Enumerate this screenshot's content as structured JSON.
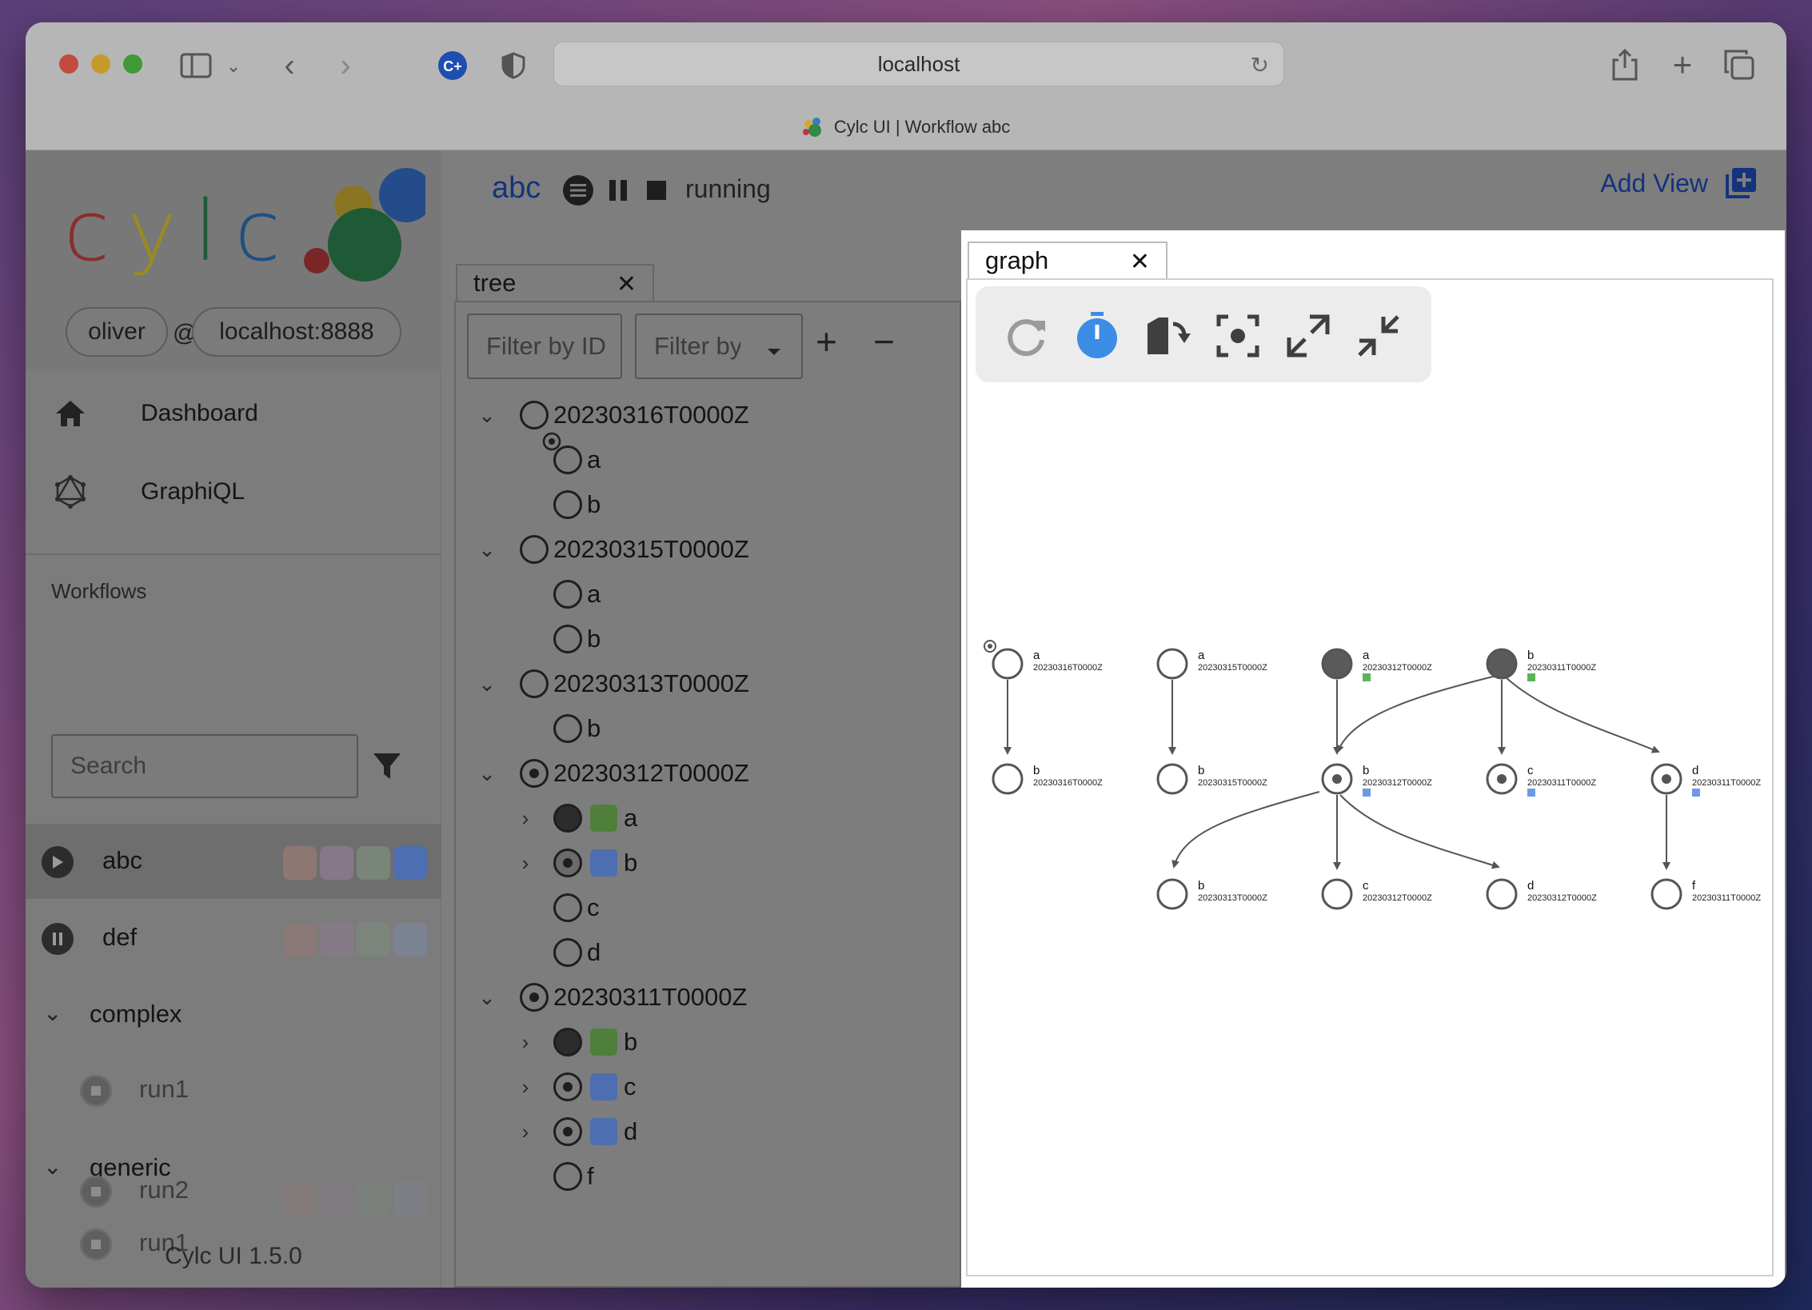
{
  "browser": {
    "url": "localhost",
    "page_title": "Cylc UI | Workflow abc"
  },
  "sidebar": {
    "logo_text": "cylc",
    "user": "oliver",
    "at": "@",
    "host": "localhost:8888",
    "nav": [
      {
        "label": "Dashboard",
        "icon": "home-icon"
      },
      {
        "label": "GraphiQL",
        "icon": "graphql-icon"
      }
    ],
    "workflows_label": "Workflows",
    "search_placeholder": "Search",
    "workflows": [
      {
        "name": "abc",
        "state": "running"
      },
      {
        "name": "def",
        "state": "paused"
      }
    ],
    "groups": [
      {
        "name": "complex",
        "runs": [
          "run1"
        ]
      },
      {
        "name": "generic",
        "runs": [
          "run1",
          "run2"
        ]
      }
    ],
    "version": "Cylc UI 1.5.0"
  },
  "toolbar": {
    "workflow_name": "abc",
    "status": "running",
    "add_view_label": "Add View"
  },
  "tree_view": {
    "tab_label": "tree",
    "filter_id_placeholder": "Filter by ID",
    "filter_state_placeholder": "Filter by state",
    "cycles": [
      {
        "id": "20230316T0000Z",
        "tasks": [
          "a",
          "b"
        ]
      },
      {
        "id": "20230315T0000Z",
        "tasks": [
          "a",
          "b"
        ]
      },
      {
        "id": "20230313T0000Z",
        "tasks": [
          "b"
        ]
      },
      {
        "id": "20230312T0000Z",
        "tasks": [
          "a",
          "b",
          "c",
          "d"
        ]
      },
      {
        "id": "20230311T0000Z",
        "tasks": [
          "b",
          "c",
          "d",
          "f"
        ]
      }
    ]
  },
  "graph_view": {
    "tab_label": "graph",
    "tools": [
      "refresh-icon",
      "timer-icon",
      "transpose-icon",
      "center-icon",
      "expand-icon",
      "collapse-icon"
    ],
    "nodes": [
      {
        "name": "a",
        "cycle": "20230316T0000Z",
        "state": "waiting",
        "queued": true
      },
      {
        "name": "b",
        "cycle": "20230316T0000Z",
        "state": "waiting"
      },
      {
        "name": "a",
        "cycle": "20230315T0000Z",
        "state": "waiting"
      },
      {
        "name": "b",
        "cycle": "20230315T0000Z",
        "state": "waiting"
      },
      {
        "name": "a",
        "cycle": "20230312T0000Z",
        "state": "succeeded"
      },
      {
        "name": "b",
        "cycle": "20230311T0000Z",
        "state": "succeeded"
      },
      {
        "name": "b",
        "cycle": "20230312T0000Z",
        "state": "running"
      },
      {
        "name": "c",
        "cycle": "20230311T0000Z",
        "state": "running"
      },
      {
        "name": "d",
        "cycle": "20230311T0000Z",
        "state": "running"
      },
      {
        "name": "b",
        "cycle": "20230313T0000Z",
        "state": "waiting"
      },
      {
        "name": "c",
        "cycle": "20230312T0000Z",
        "state": "waiting"
      },
      {
        "name": "d",
        "cycle": "20230312T0000Z",
        "state": "waiting"
      },
      {
        "name": "f",
        "cycle": "20230311T0000Z",
        "state": "waiting"
      }
    ]
  },
  "colors": {
    "accent": "#1a49c2",
    "job_succeeded": "#4f7f3b",
    "job_running": "#4d6eb0",
    "graph_job_succeeded": "#5ab55a",
    "graph_job_running": "#6a9be4",
    "timer_blue": "#3b8de6"
  }
}
